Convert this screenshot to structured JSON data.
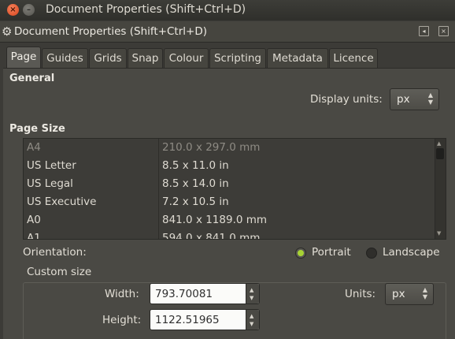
{
  "window": {
    "title": "Document Properties (Shift+Ctrl+D)",
    "close_glyph": "×",
    "minimize_glyph": "–"
  },
  "dock": {
    "title": "Document Properties (Shift+Ctrl+D)",
    "icon": "gear-icon",
    "iconify_glyph": "◂",
    "close_glyph": "×"
  },
  "tabs": [
    {
      "label": "Page",
      "active": true
    },
    {
      "label": "Guides"
    },
    {
      "label": "Grids"
    },
    {
      "label": "Snap"
    },
    {
      "label": "Colour"
    },
    {
      "label": "Scripting"
    },
    {
      "label": "Metadata"
    },
    {
      "label": "Licence"
    }
  ],
  "general": {
    "heading": "General",
    "display_units_label": "Display units:",
    "display_units_value": "px"
  },
  "page_size": {
    "heading": "Page Size",
    "rows": [
      {
        "name": "A4",
        "size": "210.0 x 297.0 mm"
      },
      {
        "name": "US Letter",
        "size": "8.5 x 11.0 in"
      },
      {
        "name": "US Legal",
        "size": "8.5 x 14.0 in"
      },
      {
        "name": "US Executive",
        "size": "7.2 x 10.5 in"
      },
      {
        "name": "A0",
        "size": "841.0 x 1189.0 mm"
      },
      {
        "name": "A1",
        "size": "594.0 x 841.0 mm"
      }
    ]
  },
  "orientation": {
    "label": "Orientation:",
    "options": [
      "Portrait",
      "Landscape"
    ],
    "selected": "Portrait"
  },
  "custom_size": {
    "label": "Custom size",
    "width_label": "Width:",
    "width_value": "793.70081",
    "height_label": "Height:",
    "height_value": "1122.51965",
    "units_label": "Units:",
    "units_value": "px"
  },
  "colors": {
    "accent_radio": "#a7d234",
    "close_button": "#e2562a"
  }
}
